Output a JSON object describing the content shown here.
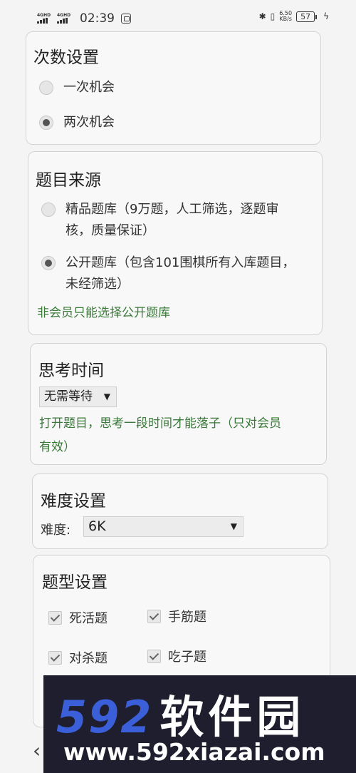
{
  "status_bar": {
    "network_1": "4GHD",
    "network_2": "4GHD",
    "time": "02:39",
    "speed_value": "6.50",
    "speed_unit": "KB/s",
    "battery": "57"
  },
  "attempts": {
    "title": "次数设置",
    "options": [
      {
        "label": "一次机会",
        "selected": false
      },
      {
        "label": "两次机会",
        "selected": true
      }
    ]
  },
  "source": {
    "title": "题目来源",
    "options": [
      {
        "label_line1": "精品题库（9万题，人工筛选，逐题审",
        "label_line2": "核，质量保证）",
        "selected": false
      },
      {
        "label_line1": "公开题库（包含101围棋所有入库题目，",
        "label_line2": "未经筛选）",
        "selected": true
      }
    ],
    "note": "非会员只能选择公开题库"
  },
  "thinking": {
    "title": "思考时间",
    "select_value": "无需等待",
    "note_line1": "打开题目，思考一段时间才能落子（只对会员",
    "note_line2": "有效）"
  },
  "difficulty": {
    "title": "难度设置",
    "label": "难度:",
    "select_value": "6K"
  },
  "types": {
    "title": "题型设置",
    "items": [
      {
        "label": "死活题",
        "checked": true
      },
      {
        "label": "手筋题",
        "checked": true
      },
      {
        "label": "对杀题",
        "checked": true
      },
      {
        "label": "吃子题",
        "checked": true
      }
    ]
  },
  "watermark": {
    "logo_number": "592",
    "logo_text": "软件园",
    "url": "www.592xiazai.com"
  }
}
